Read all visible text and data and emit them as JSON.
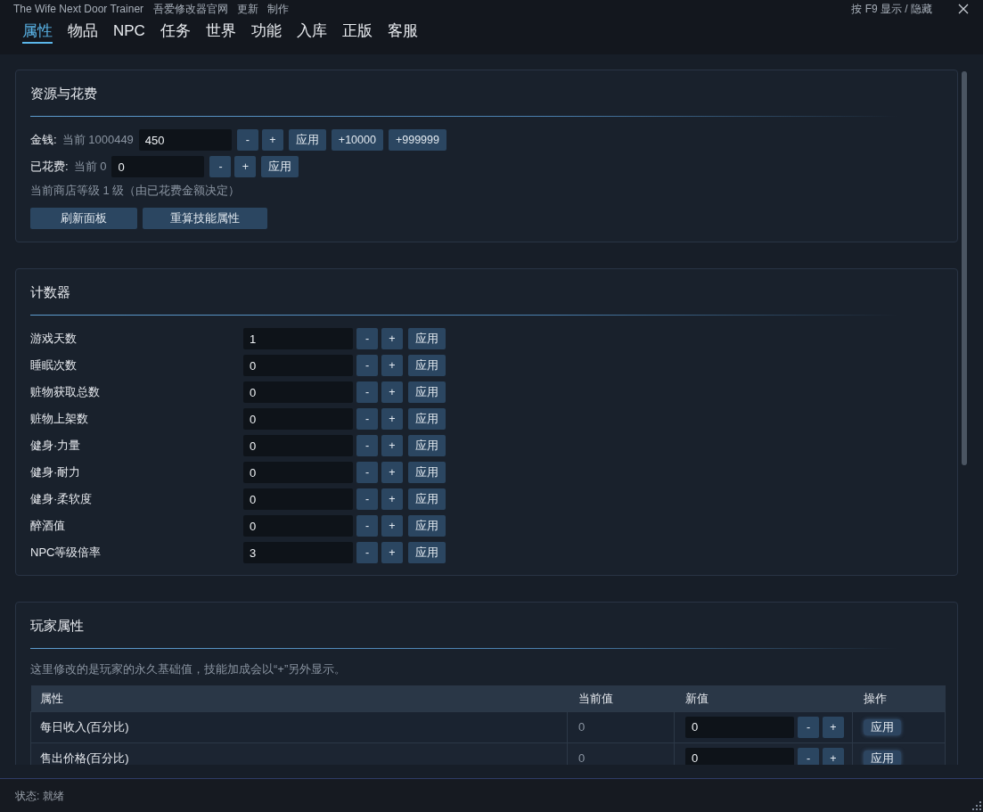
{
  "window": {
    "title": "The Wife Next Door Trainer",
    "links": [
      "吾爱修改器官网",
      "更新",
      "制作"
    ],
    "hotkey_hint": "按 F9 显示 / 隐藏"
  },
  "tabs": [
    {
      "label": "属性",
      "selected": true
    },
    {
      "label": "物品",
      "selected": false
    },
    {
      "label": "NPC",
      "selected": false
    },
    {
      "label": "任务",
      "selected": false
    },
    {
      "label": "世界",
      "selected": false
    },
    {
      "label": "功能",
      "selected": false
    },
    {
      "label": "入库",
      "selected": false
    },
    {
      "label": "正版",
      "selected": false
    },
    {
      "label": "客服",
      "selected": false
    }
  ],
  "sections": [
    {
      "kind": "resources",
      "title": "资源与花费",
      "fields": [
        {
          "label": "金钱:",
          "current": "当前 1000449",
          "value": "450",
          "buttons": [
            "-",
            "+",
            "应用",
            "+10000",
            "+999999"
          ]
        },
        {
          "label": "已花费:",
          "current": "当前 0",
          "value": "0",
          "buttons": [
            "-",
            "+",
            "应用"
          ]
        }
      ],
      "note": "当前商店等级 1 级（由已花费金额决定）",
      "actions": [
        "刷新面板",
        "重算技能属性"
      ]
    },
    {
      "kind": "counters",
      "title": "计数器",
      "rows": [
        {
          "label": "游戏天数",
          "value": "1",
          "buttons": [
            "-",
            "+",
            "应用"
          ]
        },
        {
          "label": "睡眠次数",
          "value": "0",
          "buttons": [
            "-",
            "+",
            "应用"
          ]
        },
        {
          "label": "赃物获取总数",
          "value": "0",
          "buttons": [
            "-",
            "+",
            "应用"
          ]
        },
        {
          "label": "赃物上架数",
          "value": "0",
          "buttons": [
            "-",
            "+",
            "应用"
          ]
        },
        {
          "label": "健身·力量",
          "value": "0",
          "buttons": [
            "-",
            "+",
            "应用"
          ]
        },
        {
          "label": "健身·耐力",
          "value": "0",
          "buttons": [
            "-",
            "+",
            "应用"
          ]
        },
        {
          "label": "健身·柔软度",
          "value": "0",
          "buttons": [
            "-",
            "+",
            "应用"
          ]
        },
        {
          "label": "醉酒值",
          "value": "0",
          "buttons": [
            "-",
            "+",
            "应用"
          ]
        },
        {
          "label": "NPC等级倍率",
          "value": "3",
          "buttons": [
            "-",
            "+",
            "应用"
          ]
        }
      ]
    },
    {
      "kind": "attributes",
      "title": "玩家属性",
      "note": "这里修改的是玩家的永久基础值，技能加成会以“+”另外显示。",
      "table": {
        "columns": [
          "属性",
          "当前值",
          "新值",
          "操作"
        ],
        "rows": [
          {
            "name": "每日收入(百分比)",
            "current": "0",
            "value": "0",
            "buttons": [
              "-",
              "+"
            ],
            "action": "应用"
          },
          {
            "name": "售出价格(百分比)",
            "current": "0",
            "value": "0",
            "buttons": [
              "-",
              "+"
            ],
            "action": "应用"
          }
        ]
      }
    }
  ],
  "status_bar": {
    "text": "状态: 就绪"
  }
}
